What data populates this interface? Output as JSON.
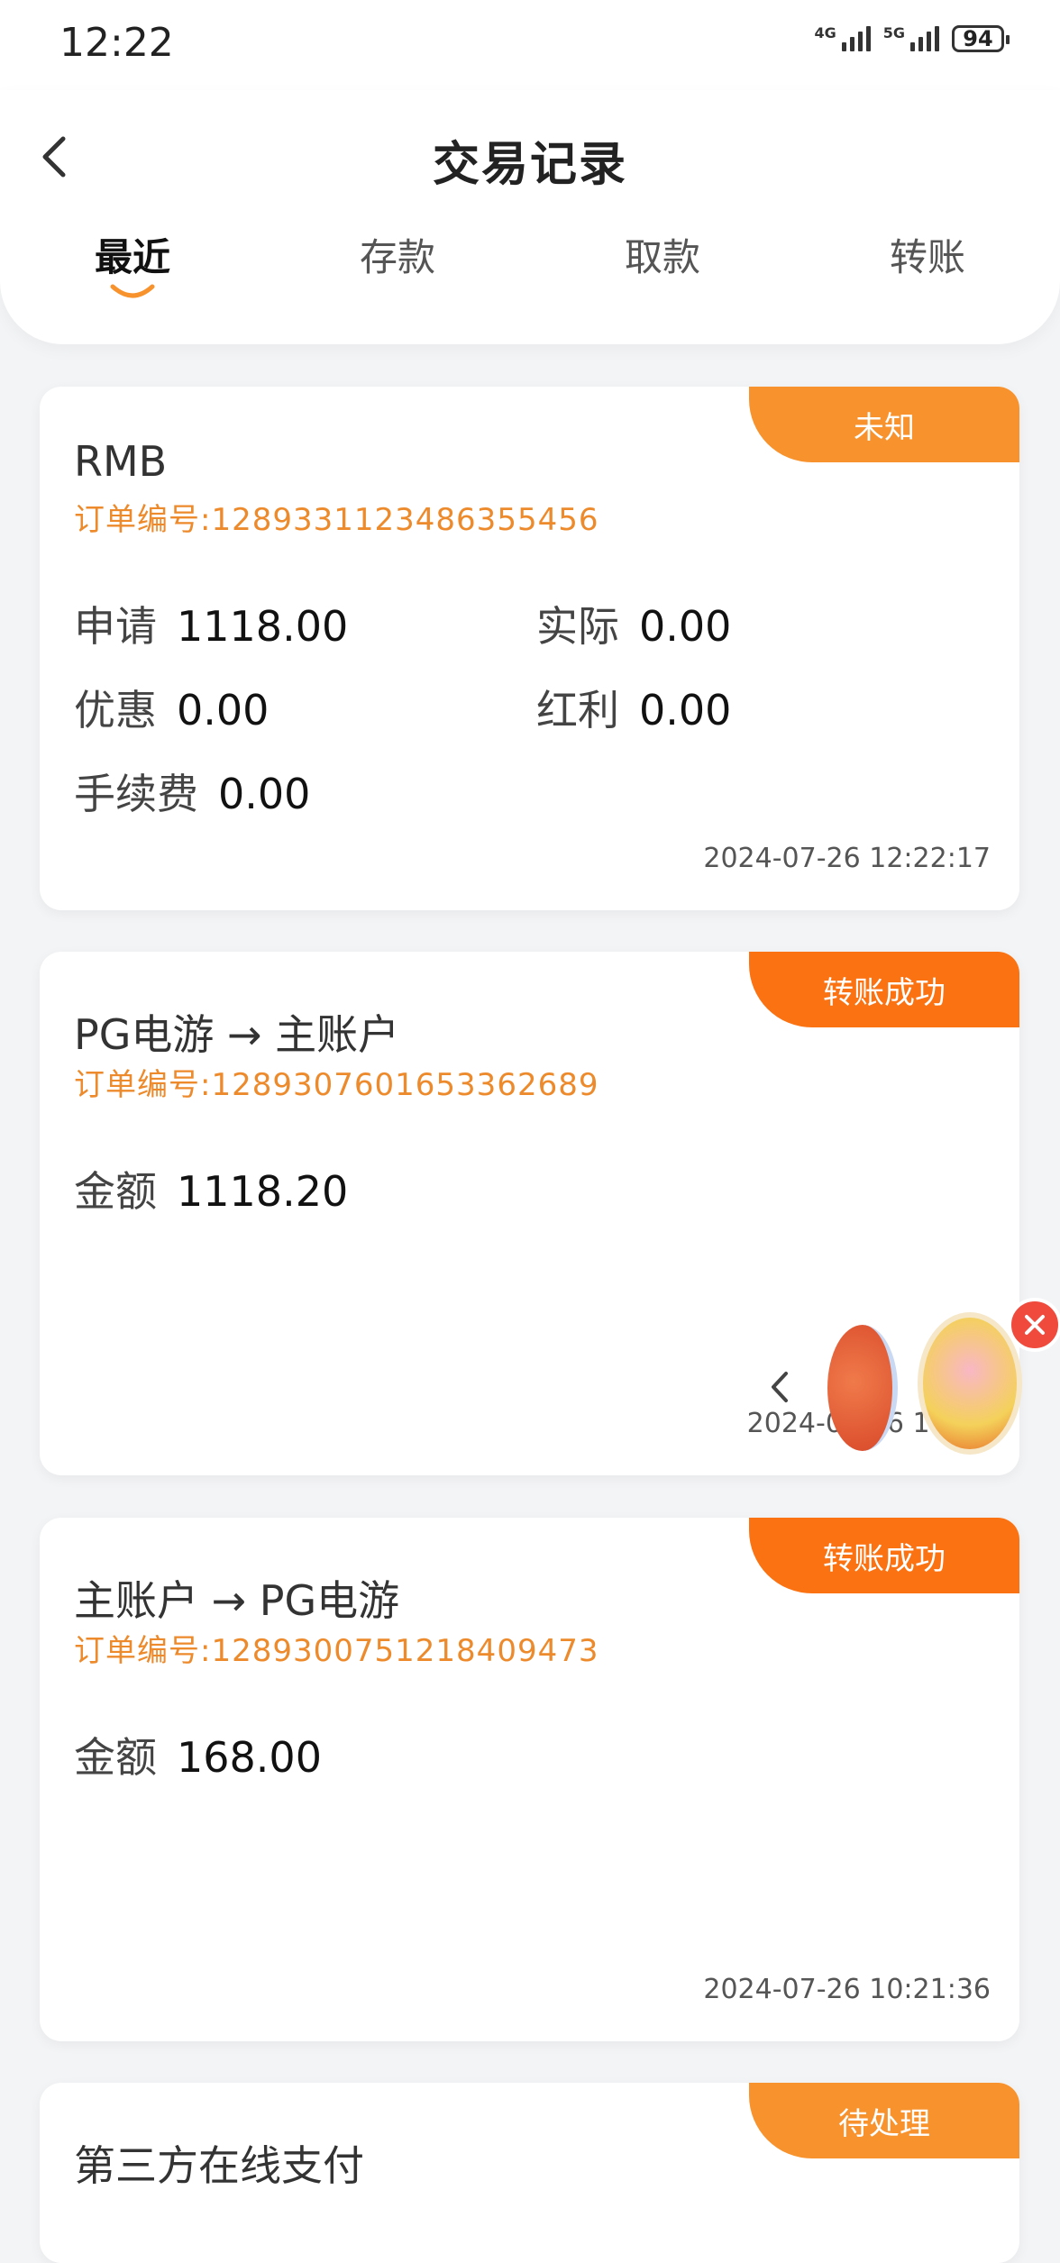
{
  "status_bar": {
    "time": "12:22",
    "network1": "4G",
    "network2": "5G",
    "battery": "94"
  },
  "header": {
    "title": "交易记录",
    "tabs": [
      {
        "label": "最近",
        "active": true
      },
      {
        "label": "存款",
        "active": false
      },
      {
        "label": "取款",
        "active": false
      },
      {
        "label": "转账",
        "active": false
      }
    ]
  },
  "colors": {
    "accent": "#ec8a2c",
    "badge_unknown": "#f7922c",
    "badge_success": "#fb7212",
    "badge_pending": "#f7922c",
    "close": "#f04a3d"
  },
  "records": [
    {
      "badge": "未知",
      "title": "RMB",
      "order_label": "订单编号:",
      "order_no": "1289331123486355456",
      "fields": {
        "apply_label": "申请",
        "apply_value": "1118.00",
        "actual_label": "实际",
        "actual_value": "0.00",
        "discount_label": "优惠",
        "discount_value": "0.00",
        "bonus_label": "红利",
        "bonus_value": "0.00",
        "fee_label": "手续费",
        "fee_value": "0.00"
      },
      "time": "2024-07-26 12:22:17"
    },
    {
      "badge": "转账成功",
      "title": "PG电游 → 主账户",
      "order_label": "订单编号:",
      "order_no": "1289307601653362689",
      "amount_label": "金额",
      "amount_value": "1118.20",
      "time": "2024-07-26 10:44"
    },
    {
      "badge": "转账成功",
      "title": "主账户 → PG电游",
      "order_label": "订单编号:",
      "order_no": "1289300751218409473",
      "amount_label": "金额",
      "amount_value": "168.00",
      "time": "2024-07-26 10:21:36"
    },
    {
      "badge": "待处理",
      "title": "第三方在线支付"
    }
  ],
  "float_widget": {
    "icons": [
      "chevron-left-icon",
      "promo-coin-icon",
      "promo-gift-icon",
      "close-icon"
    ]
  }
}
